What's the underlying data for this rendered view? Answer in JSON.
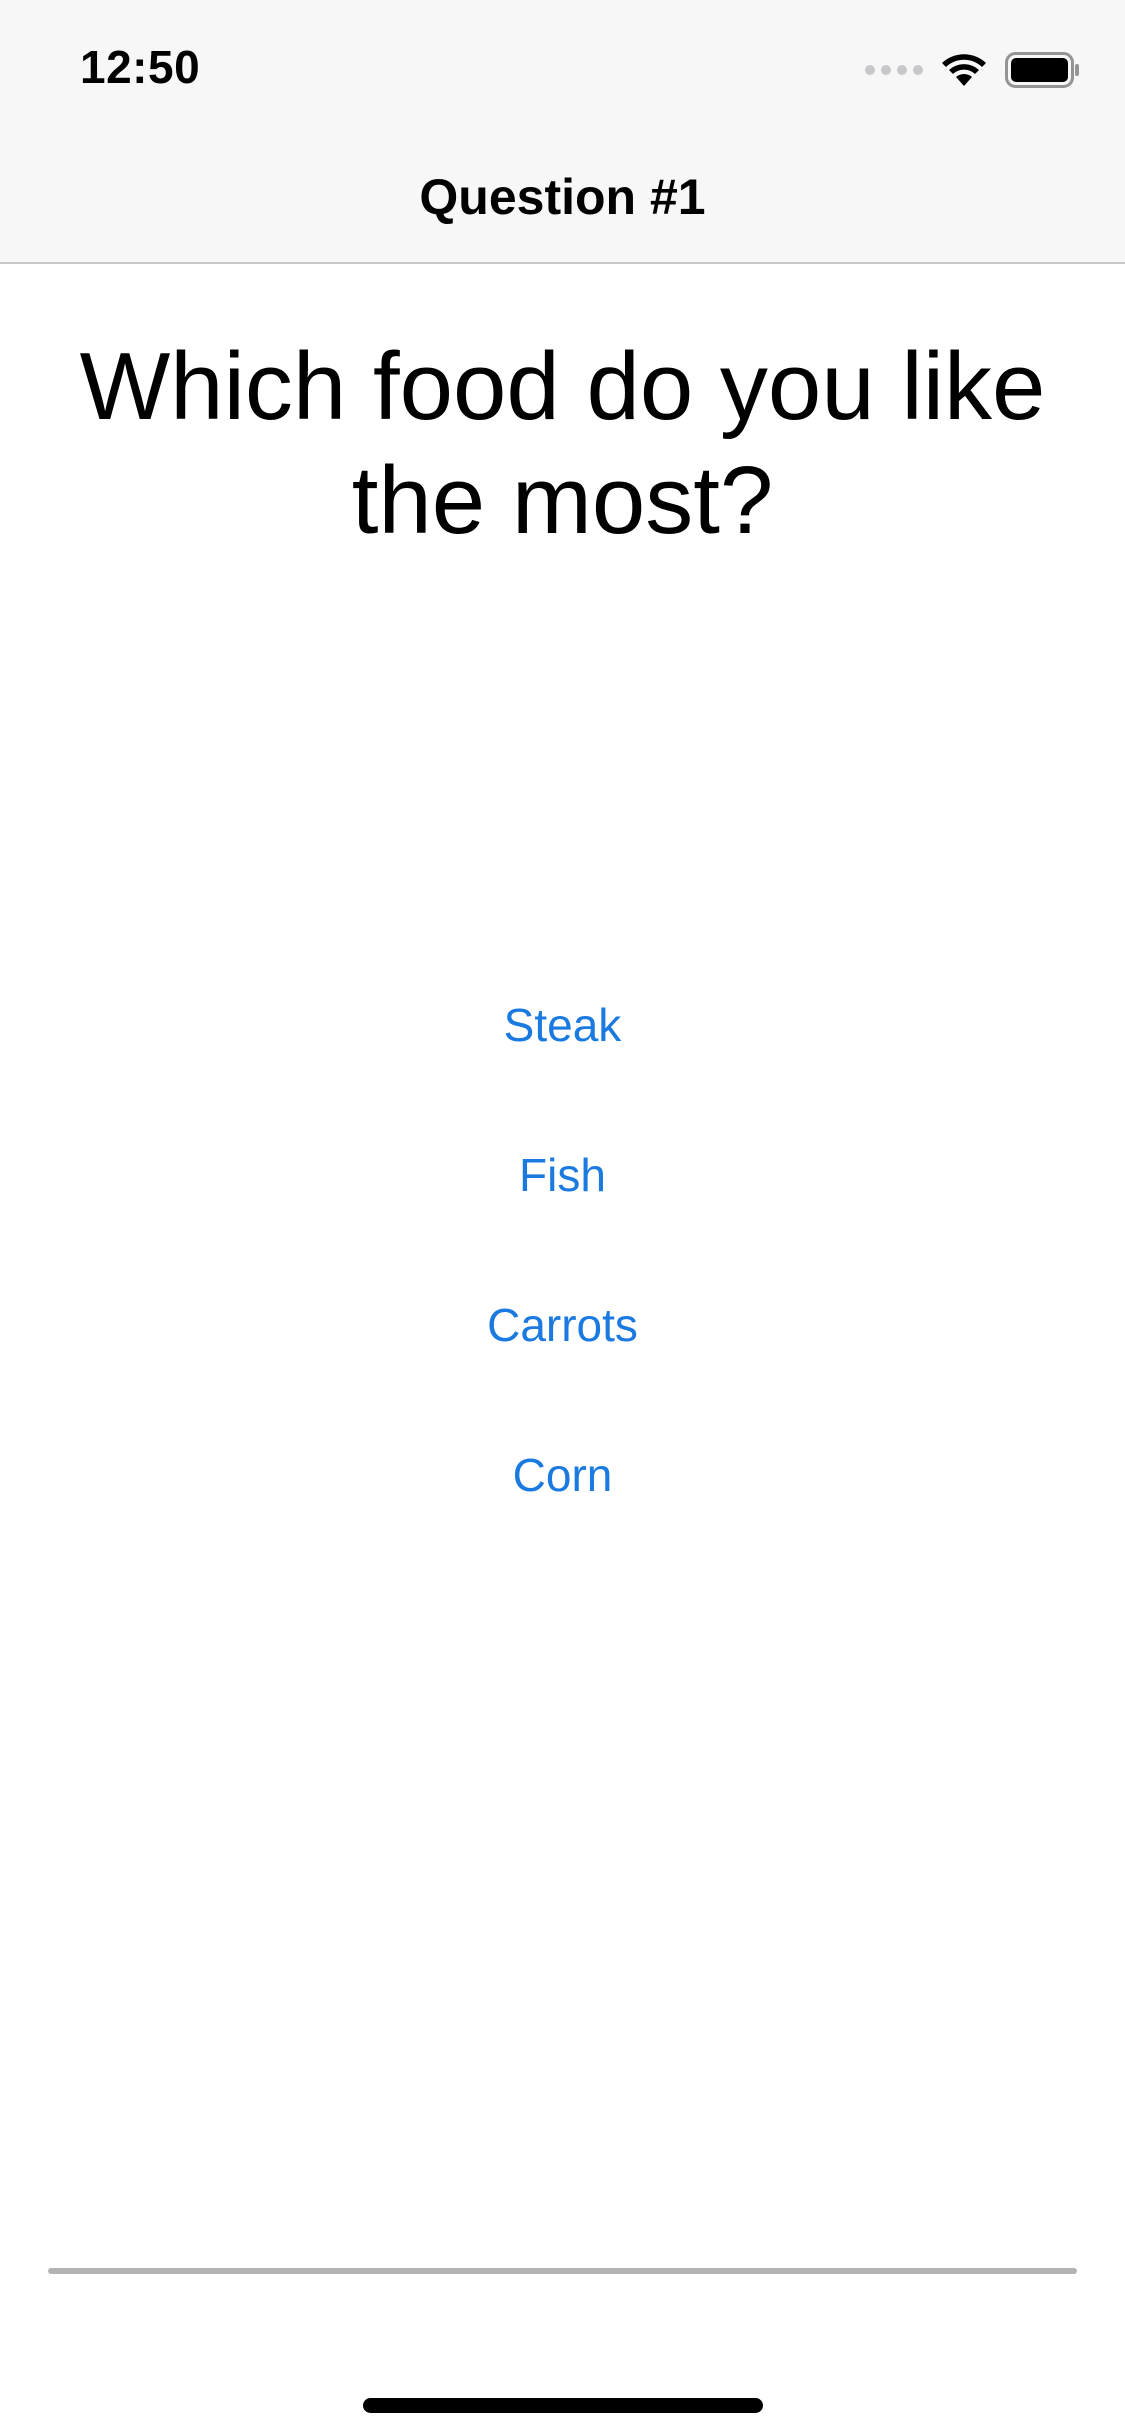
{
  "status_bar": {
    "time": "12:50",
    "icons": [
      "signal-dots-icon",
      "wifi-icon",
      "battery-icon"
    ]
  },
  "nav_bar": {
    "title": "Question #1"
  },
  "question": {
    "text": "Which food do you like the most?"
  },
  "answers": [
    {
      "label": "Steak"
    },
    {
      "label": "Fish"
    },
    {
      "label": "Carrots"
    },
    {
      "label": "Corn"
    }
  ],
  "colors": {
    "accent": "#1a7ae0",
    "bar_background": "#f7f7f7",
    "progress_track": "#b3b3b3"
  }
}
